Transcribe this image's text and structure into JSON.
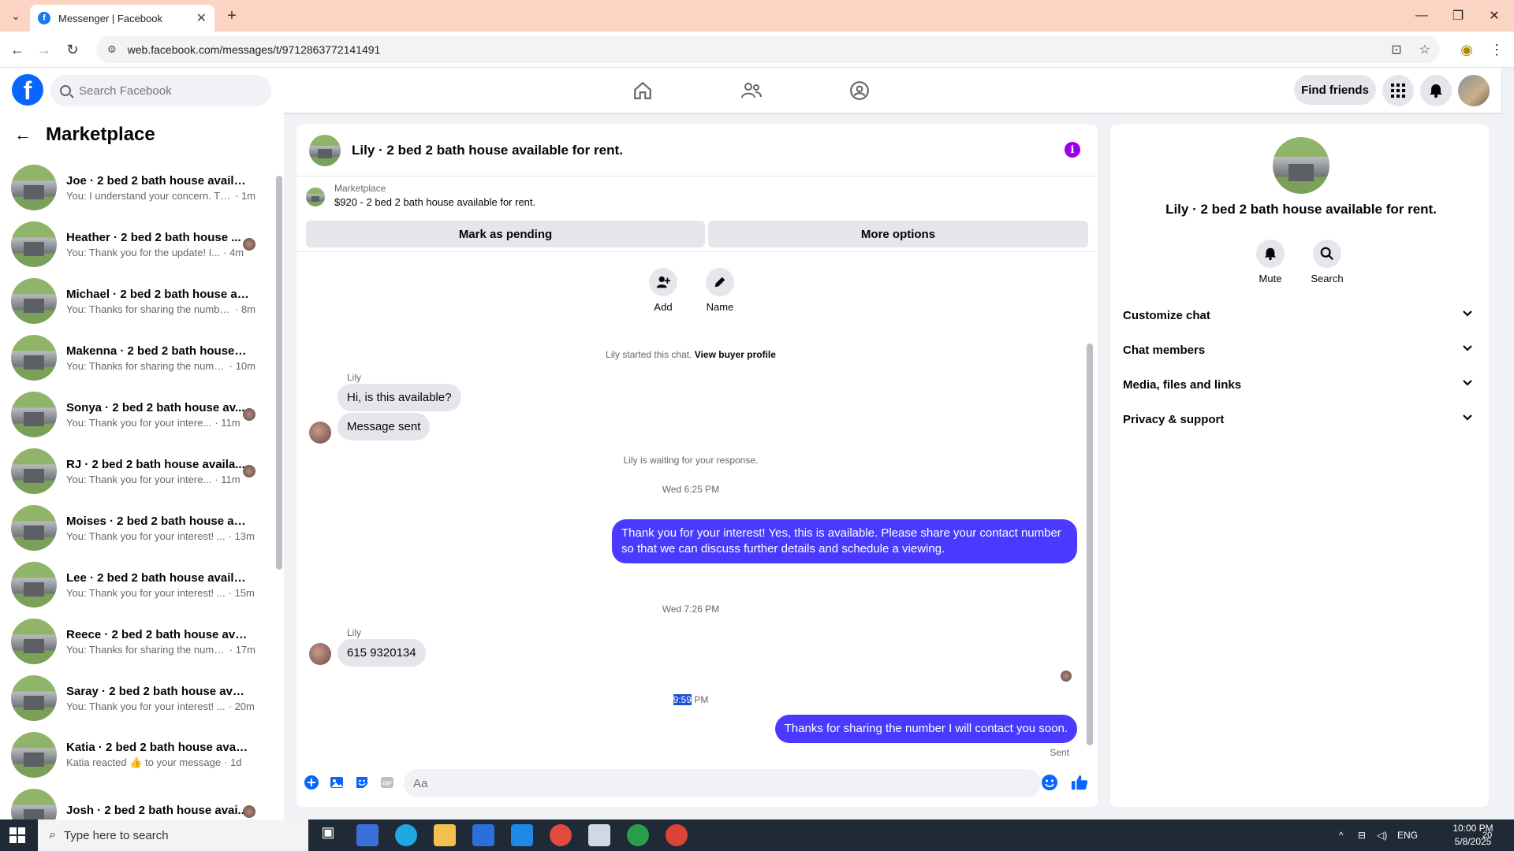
{
  "browser": {
    "tab_title": "Messenger | Facebook",
    "url": "web.facebook.com/messages/t/9712863772141491"
  },
  "header": {
    "search_placeholder": "Search Facebook",
    "find_friends": "Find friends"
  },
  "left_panel": {
    "title": "Marketplace",
    "conversations": [
      {
        "name": "Joe · 2 bed 2 bath house availab...",
        "preview": "You: I understand your concern. Th...",
        "time": "1m",
        "seen": false
      },
      {
        "name": "Heather · 2 bed 2 bath house ...",
        "preview": "You: Thank you for the update! I...",
        "time": "4m",
        "seen": true
      },
      {
        "name": "Michael · 2 bed 2 bath house av...",
        "preview": "You: Thanks for sharing the numbe...",
        "time": "8m",
        "seen": false
      },
      {
        "name": "Makenna · 2 bed 2 bath house a...",
        "preview": "You: Thanks for sharing the numb...",
        "time": "10m",
        "seen": false
      },
      {
        "name": "Sonya · 2 bed 2 bath house av...",
        "preview": "You: Thank you for your intere...",
        "time": "11m",
        "seen": true
      },
      {
        "name": "RJ · 2 bed 2 bath house availa...",
        "preview": "You: Thank you for your intere...",
        "time": "11m",
        "seen": true
      },
      {
        "name": "Moises · 2 bed 2 bath house ava...",
        "preview": "You: Thank you for your interest! ...",
        "time": "13m",
        "seen": false
      },
      {
        "name": "Lee · 2 bed 2 bath house availab...",
        "preview": "You: Thank you for your interest! ...",
        "time": "15m",
        "seen": false
      },
      {
        "name": "Reece · 2 bed 2 bath house avail...",
        "preview": "You: Thanks for sharing the numb...",
        "time": "17m",
        "seen": false
      },
      {
        "name": "Saray · 2 bed 2 bath house avail...",
        "preview": "You: Thank you for your interest! ...",
        "time": "20m",
        "seen": false
      },
      {
        "name": "Katia · 2 bed 2 bath house availa...",
        "preview": "Katia reacted 👍 to your message",
        "time": "1d",
        "seen": false
      },
      {
        "name": "Josh · 2 bed 2 bath house avai...",
        "preview": "",
        "time": "",
        "seen": true
      }
    ]
  },
  "chat": {
    "title": "Lily · 2 bed 2 bath house available for rent.",
    "marketplace_label": "Marketplace",
    "listing": "$920 - 2 bed 2 bath house available for rent.",
    "mark_pending": "Mark as pending",
    "more_options": "More options",
    "add_label": "Add",
    "name_label": "Name",
    "started_text": "Lily started this chat.",
    "view_profile": "View buyer profile",
    "sender1": "Lily",
    "msg1": "Hi, is this available?",
    "msg2": "Message sent",
    "waiting": "Lily is waiting for your response.",
    "time1": "Wed 6:25 PM",
    "out1": "Thank you for your interest! Yes, this is available. Please share your contact number so that we can discuss further details and schedule a viewing.",
    "time2": "Wed 7:26 PM",
    "sender2": "Lily",
    "msg3": "615 9320134",
    "time3_sel": "9:59",
    "time3_rest": " PM",
    "out2": "Thanks for sharing the number I will contact you soon.",
    "sent": "Sent",
    "composer_placeholder": "Aa"
  },
  "right_panel": {
    "title": "Lily · 2 bed 2 bath house available for rent.",
    "mute": "Mute",
    "search": "Search",
    "sections": [
      "Customize chat",
      "Chat members",
      "Media, files and links",
      "Privacy & support"
    ]
  },
  "taskbar": {
    "search_placeholder": "Type here to search",
    "lang": "ENG",
    "time": "10:00 PM",
    "date": "5/8/2025",
    "notifications": "20"
  },
  "colors": {
    "accent": "#4a3aff",
    "fb_blue": "#0866ff",
    "info_purple": "#9b00e8"
  }
}
